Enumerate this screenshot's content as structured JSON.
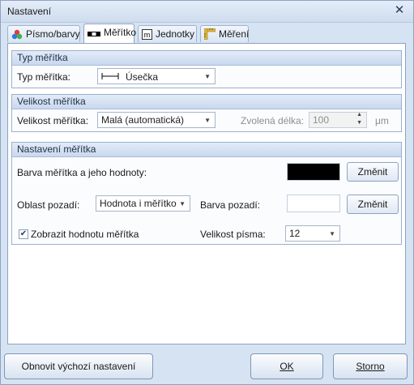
{
  "window": {
    "title": "Nastavení"
  },
  "tabs": [
    {
      "label": "Písmo/barvy",
      "icon": "color-dots-icon"
    },
    {
      "label": "Měřítko",
      "icon": "scale-bar-icon"
    },
    {
      "label": "Jednotky",
      "icon": "units-icon"
    },
    {
      "label": "Měření",
      "icon": "ruler-icon"
    }
  ],
  "typ_meritka": {
    "header": "Typ měřítka",
    "label": "Typ měřítka:",
    "value": "Úsečka"
  },
  "velikost_meritka": {
    "header": "Velikost měřítka",
    "label": "Velikost měřítka:",
    "value": "Malá (automatická)",
    "zvolena_label": "Zvolená délka:",
    "zvolena_value": "100",
    "unit": "μm"
  },
  "nastaveni_meritka": {
    "header": "Nastavení měřítka",
    "barva_label": "Barva měřítka a jeho hodnoty:",
    "barva_color": "#000000",
    "change_label": "Změnit",
    "oblast_label": "Oblast pozadí:",
    "oblast_value": "Hodnota i měřítko",
    "barva_pozadi_label": "Barva pozadí:",
    "barva_pozadi_color": "#ffffff",
    "zobrazit_label": "Zobrazit hodnotu měřítka",
    "zobrazit_checked": true,
    "velikost_pisma_label": "Velikost písma:",
    "velikost_pisma_value": "12"
  },
  "footer": {
    "reset_label": "Obnovit výchozí nastavení",
    "ok_label": "OK",
    "cancel_label": "Storno"
  }
}
